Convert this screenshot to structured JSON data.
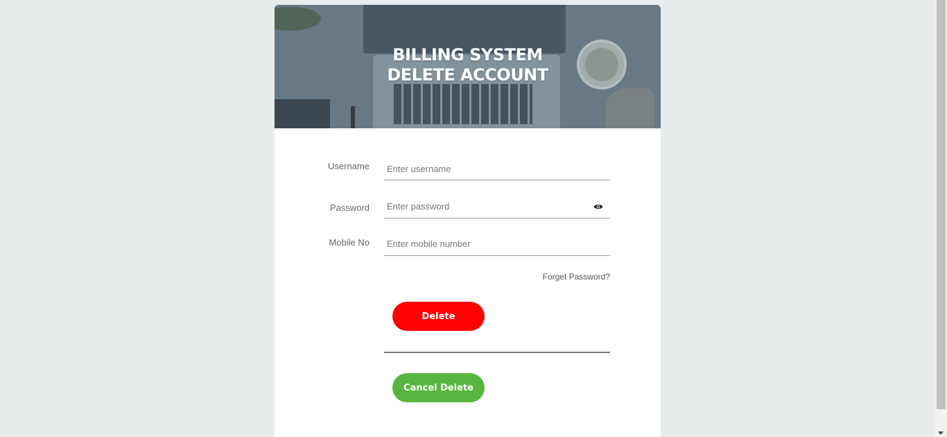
{
  "header": {
    "title_line1": "BILLING SYSTEM",
    "title_line2": "DELETE ACCOUNT"
  },
  "form": {
    "username": {
      "label": "Username",
      "placeholder": "Enter username",
      "value": ""
    },
    "password": {
      "label": "Password",
      "placeholder": "Enter password",
      "value": "",
      "toggle_icon": "eye-icon"
    },
    "mobile": {
      "label": "Mobile No",
      "placeholder": "Enter mobile number",
      "value": ""
    },
    "forgot_label": "Forget Password?",
    "delete_label": "Delete",
    "cancel_label": "Cancel Delete"
  },
  "colors": {
    "delete_button": "#ff0000",
    "cancel_button": "#56b63f",
    "page_background": "#e9ecec"
  }
}
